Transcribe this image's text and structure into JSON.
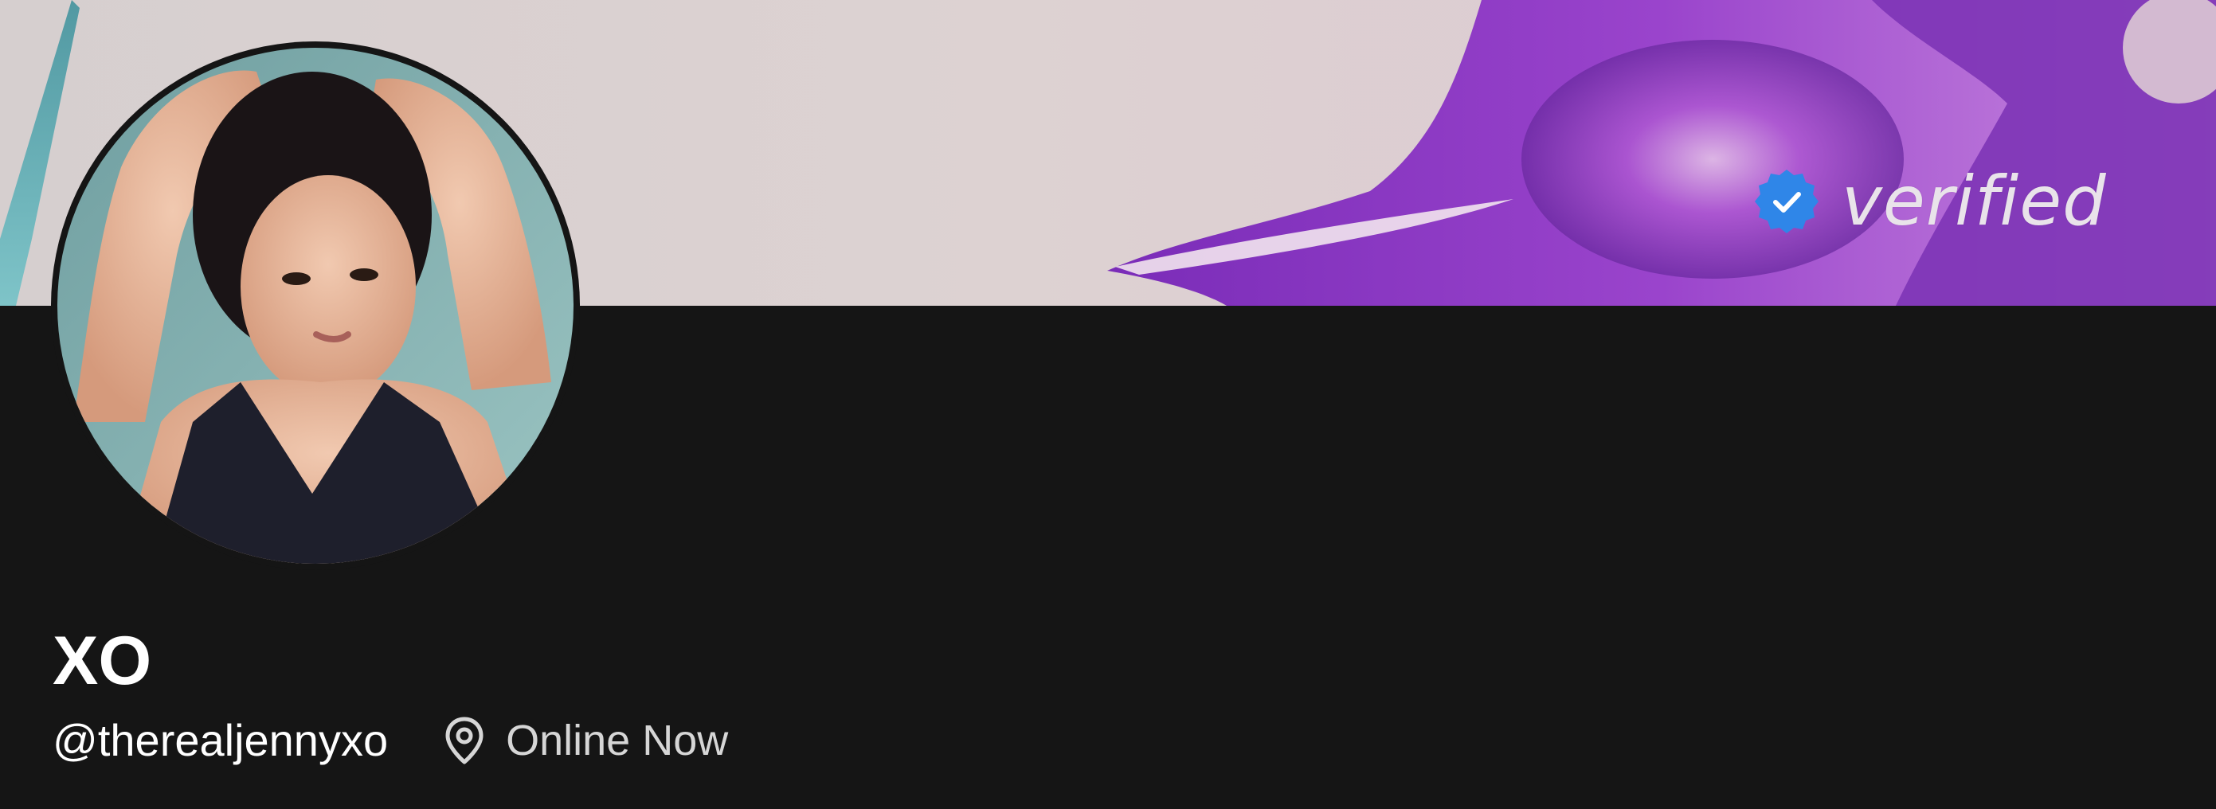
{
  "banner": {
    "badge_text": "verified",
    "badge_icon": "verified-check-icon",
    "badge_color": "#2f86e8"
  },
  "profile": {
    "avatar_icon": "profile-avatar",
    "display_name": "XO",
    "handle": "@therealjennyxo",
    "location_icon": "map-pin-icon",
    "status": "Online Now"
  },
  "colors": {
    "background": "#151515",
    "banner_base": "#ddd0d0",
    "banner_accent": "#8e3cc4",
    "name_text": "#ffffff",
    "status_text": "#d6d6d6"
  }
}
